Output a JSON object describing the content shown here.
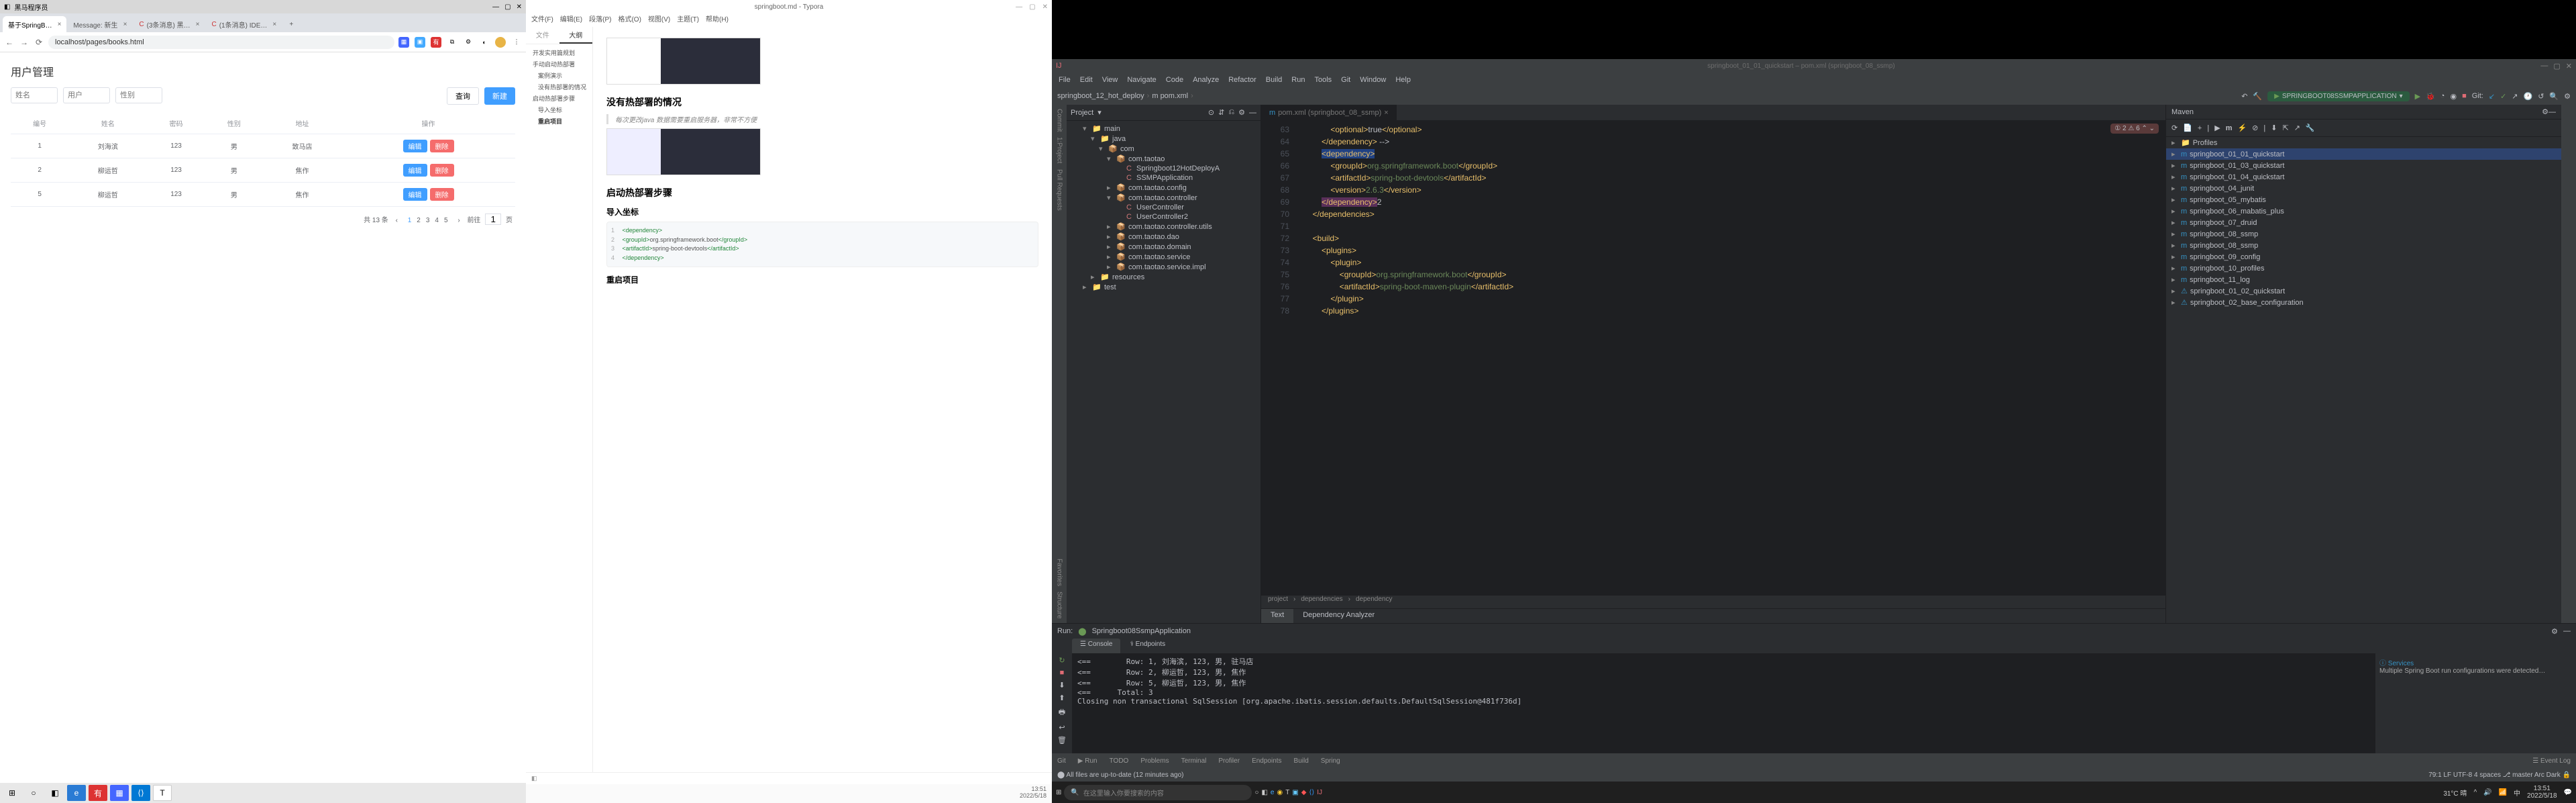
{
  "browser": {
    "win_title": "黑马程序员",
    "tabs": [
      {
        "label": "基于SpringB…"
      },
      {
        "label": "Message: 新生"
      },
      {
        "label": "(3条消息) 黑…"
      },
      {
        "label": "(1条消息) IDE…"
      }
    ],
    "url": "localhost/pages/books.html",
    "page": {
      "title": "用户管理",
      "filter": {
        "p1": "姓名",
        "p2": "用户",
        "p3": "性别",
        "btn_query": "查询",
        "btn_new": "新建"
      },
      "cols": [
        "编号",
        "姓名",
        "密码",
        "性别",
        "地址",
        "操作"
      ],
      "rows": [
        {
          "id": "1",
          "name": "刘海滨",
          "pwd": "123",
          "sex": "男",
          "addr": "致马店"
        },
        {
          "id": "2",
          "name": "柳运哲",
          "pwd": "123",
          "sex": "男",
          "addr": "焦作"
        },
        {
          "id": "5",
          "name": "柳运哲",
          "pwd": "123",
          "sex": "男",
          "addr": "焦作"
        }
      ],
      "btn_edit": "编辑",
      "btn_del": "删除",
      "pager": {
        "total": "共 13 条",
        "pages": [
          "1",
          "2",
          "3",
          "4",
          "5"
        ],
        "goto": "前往",
        "page_suffix": "页",
        "input": "1"
      }
    }
  },
  "typora": {
    "title": "springboot.md - Typora",
    "menu": [
      "文件(F)",
      "编辑(E)",
      "段落(P)",
      "格式(O)",
      "视图(V)",
      "主题(T)",
      "帮助(H)"
    ],
    "side_tabs": {
      "file": "文件",
      "outline": "大纲"
    },
    "outline": [
      {
        "t": "开发实用篇规划",
        "ind": 0
      },
      {
        "t": "手动启动热部署",
        "ind": 0
      },
      {
        "t": "案例演示",
        "ind": 1
      },
      {
        "t": "没有热部署的情况",
        "ind": 1
      },
      {
        "t": "启动热部署步骤",
        "ind": 0
      },
      {
        "t": "导入坐标",
        "ind": 1
      },
      {
        "t": "重启项目",
        "ind": 1,
        "b": true
      }
    ],
    "content": {
      "h_nodeploy": "没有热部署的情况",
      "quote": "每次更改java 数据需要重启服务器，非常不方便",
      "h_steps": "启动热部署步骤",
      "h_import": "导入坐标",
      "code_lines": [
        "<dependency>",
        "    <groupId>org.springframework.boot</groupId>",
        "    <artifactId>spring-boot-devtools</artifactId>",
        "</dependency>"
      ],
      "h_restart": "重启项目"
    },
    "status_right": "13:51",
    "status_date": "2022/5/18"
  },
  "intellij": {
    "title_dim": "springboot_01_01_quickstart – pom.xml (springboot_08_ssmp)",
    "menu": [
      "File",
      "Edit",
      "View",
      "Navigate",
      "Code",
      "Analyze",
      "Refactor",
      "Build",
      "Run",
      "Tools",
      "Git",
      "Window",
      "Help"
    ],
    "breadcrumb": [
      "springboot_12_hot_deploy",
      "m pom.xml"
    ],
    "run_config": "SPRINGBOOT08SSMPAPPLICATION",
    "git_label": "Git:",
    "left_tabs": [
      "Commit",
      "Project",
      "Pull Requests",
      "Favorites",
      "Structure"
    ],
    "project": {
      "header": "Project",
      "tree": [
        {
          "ind": 2,
          "arr": "▾",
          "ico": "📁",
          "label": "main",
          "c": "#888"
        },
        {
          "ind": 3,
          "arr": "▾",
          "ico": "📁",
          "label": "java"
        },
        {
          "ind": 4,
          "arr": "▾",
          "ico": "📦",
          "label": "com"
        },
        {
          "ind": 5,
          "arr": "▾",
          "ico": "📦",
          "label": "com.taotao"
        },
        {
          "ind": 6,
          "arr": "",
          "ico": "C",
          "label": "Springboot12HotDeployA",
          "c": "#c77"
        },
        {
          "ind": 6,
          "arr": "",
          "ico": "C",
          "label": "SSMPApplication",
          "c": "#c77"
        },
        {
          "ind": 5,
          "arr": "▸",
          "ico": "📦",
          "label": "com.taotao.config"
        },
        {
          "ind": 5,
          "arr": "▾",
          "ico": "📦",
          "label": "com.taotao.controller"
        },
        {
          "ind": 6,
          "arr": "",
          "ico": "C",
          "label": "UserController",
          "c": "#c77"
        },
        {
          "ind": 6,
          "arr": "",
          "ico": "C",
          "label": "UserController2",
          "c": "#c77"
        },
        {
          "ind": 5,
          "arr": "▸",
          "ico": "📦",
          "label": "com.taotao.controller.utils"
        },
        {
          "ind": 5,
          "arr": "▸",
          "ico": "📦",
          "label": "com.taotao.dao"
        },
        {
          "ind": 5,
          "arr": "▸",
          "ico": "📦",
          "label": "com.taotao.domain"
        },
        {
          "ind": 5,
          "arr": "▸",
          "ico": "📦",
          "label": "com.taotao.service"
        },
        {
          "ind": 5,
          "arr": "▸",
          "ico": "📦",
          "label": "com.taotao.service.impl"
        },
        {
          "ind": 3,
          "arr": "▸",
          "ico": "📁",
          "label": "resources"
        },
        {
          "ind": 2,
          "arr": "▸",
          "ico": "📁",
          "label": "test",
          "c": "#888"
        }
      ]
    },
    "editor": {
      "tab": "pom.xml (springboot_08_ssmp)",
      "err": "① 2  ⚠ 6  ⌃ ⌄",
      "crumbs": [
        "project",
        "dependencies",
        "dependency"
      ],
      "subtabs": {
        "text": "Text",
        "da": "Dependency Analyzer"
      },
      "lines": [
        {
          "n": 63,
          "html": "                <span class='c-tag'>&lt;optional&gt;</span>true<span class='c-tag'>&lt;/optional&gt;</span>"
        },
        {
          "n": 64,
          "html": "            <span class='c-tag'>&lt;/dependency&gt;</span> --&gt;"
        },
        {
          "n": 65,
          "html": "            <span class='c-sel'><span class='c-tag'>&lt;dependency&gt;</span></span>"
        },
        {
          "n": 66,
          "html": "                <span class='c-tag'>&lt;groupId&gt;</span><span class='c-val'>org.springframework.boot</span><span class='c-tag'>&lt;/groupId&gt;</span>"
        },
        {
          "n": 67,
          "html": "                <span class='c-tag'>&lt;artifactId&gt;</span><span class='c-val'>spring-boot-devtools</span><span class='c-tag'>&lt;/artifactId&gt;</span>"
        },
        {
          "n": 68,
          "html": "                <span class='c-tag'>&lt;version&gt;</span><span class='c-val'>2.6.3</span><span class='c-tag'>&lt;/version&gt;</span>"
        },
        {
          "n": 69,
          "html": "            <span class='c-cur'><span class='c-tag'>&lt;/dependency&gt;</span></span>2"
        },
        {
          "n": 70,
          "html": "        <span class='c-tag'>&lt;/dependencies&gt;</span>"
        },
        {
          "n": 71,
          "html": ""
        },
        {
          "n": 72,
          "html": "        <span class='c-tag'>&lt;build&gt;</span>"
        },
        {
          "n": 73,
          "html": "            <span class='c-tag'>&lt;plugins&gt;</span>"
        },
        {
          "n": 74,
          "html": "                <span class='c-tag'>&lt;plugin&gt;</span>"
        },
        {
          "n": 75,
          "html": "                    <span class='c-tag'>&lt;groupId&gt;</span><span class='c-val'>org.springframework.boot</span><span class='c-tag'>&lt;/groupId&gt;</span>"
        },
        {
          "n": 76,
          "html": "                    <span class='c-tag'>&lt;artifactId&gt;</span><span class='c-val'>spring-boot-maven-plugin</span><span class='c-tag'>&lt;/artifactId&gt;</span>"
        },
        {
          "n": 77,
          "html": "                <span class='c-tag'>&lt;/plugin&gt;</span>"
        },
        {
          "n": 78,
          "html": "            <span class='c-tag'>&lt;/plugins&gt;</span>"
        }
      ]
    },
    "maven": {
      "header": "Maven",
      "items": [
        {
          "label": "Profiles",
          "ico": "📁"
        },
        {
          "label": "springboot_01_01_quickstart",
          "ico": "m",
          "sel": true
        },
        {
          "label": "springboot_01_03_quickstart",
          "ico": "m"
        },
        {
          "label": "springboot_01_04_quickstart",
          "ico": "m"
        },
        {
          "label": "springboot_04_junit",
          "ico": "m"
        },
        {
          "label": "springboot_05_mybatis",
          "ico": "m"
        },
        {
          "label": "springboot_06_mabatis_plus",
          "ico": "m"
        },
        {
          "label": "springboot_07_druid",
          "ico": "m"
        },
        {
          "label": "springboot_08_ssmp",
          "ico": "m"
        },
        {
          "label": "springboot_08_ssmp",
          "ico": "m"
        },
        {
          "label": "springboot_09_config",
          "ico": "m"
        },
        {
          "label": "springboot_10_profiles",
          "ico": "m"
        },
        {
          "label": "springboot_11_log",
          "ico": "m"
        },
        {
          "label": "springboot_01_02_quickstart",
          "ico": "⚠"
        },
        {
          "label": "springboot_02_base_configuration",
          "ico": "⚠"
        }
      ]
    },
    "run": {
      "header": "Run:",
      "app": "Springboot08SsmpApplication",
      "tabs": {
        "console": "Console",
        "endpoints": "Endpoints"
      },
      "output": [
        "<==        Row: 1, 刘海滨, 123, 男, 驻马店",
        "<==        Row: 2, 柳运哲, 123, 男, 焦作",
        "<==        Row: 5, 柳运哲, 123, 男, 焦作",
        "<==      Total: 3",
        "Closing non transactional SqlSession [org.apache.ibatis.session.defaults.DefaultSqlSession@481f736d]"
      ],
      "services_hdr": "Services",
      "services_msg": "Multiple Spring Boot run configurations were detected…"
    },
    "bottom_tabs": [
      "Git",
      "Run",
      "TODO",
      "Problems",
      "Terminal",
      "Profiler",
      "Endpoints",
      "Build",
      "Spring"
    ],
    "event_log": "Event Log",
    "status": {
      "left": "All files are up-to-date (12 minutes ago)",
      "right": [
        "79:1",
        "LF",
        "UTF-8",
        "4 spaces",
        "⎇ master"
      ]
    },
    "arc": "Arc Dark"
  },
  "taskbar3": {
    "search_ph": "在这里输入你要搜索的内容",
    "weather": "31°C 晴",
    "time": "13:51",
    "date": "2022/5/18"
  }
}
